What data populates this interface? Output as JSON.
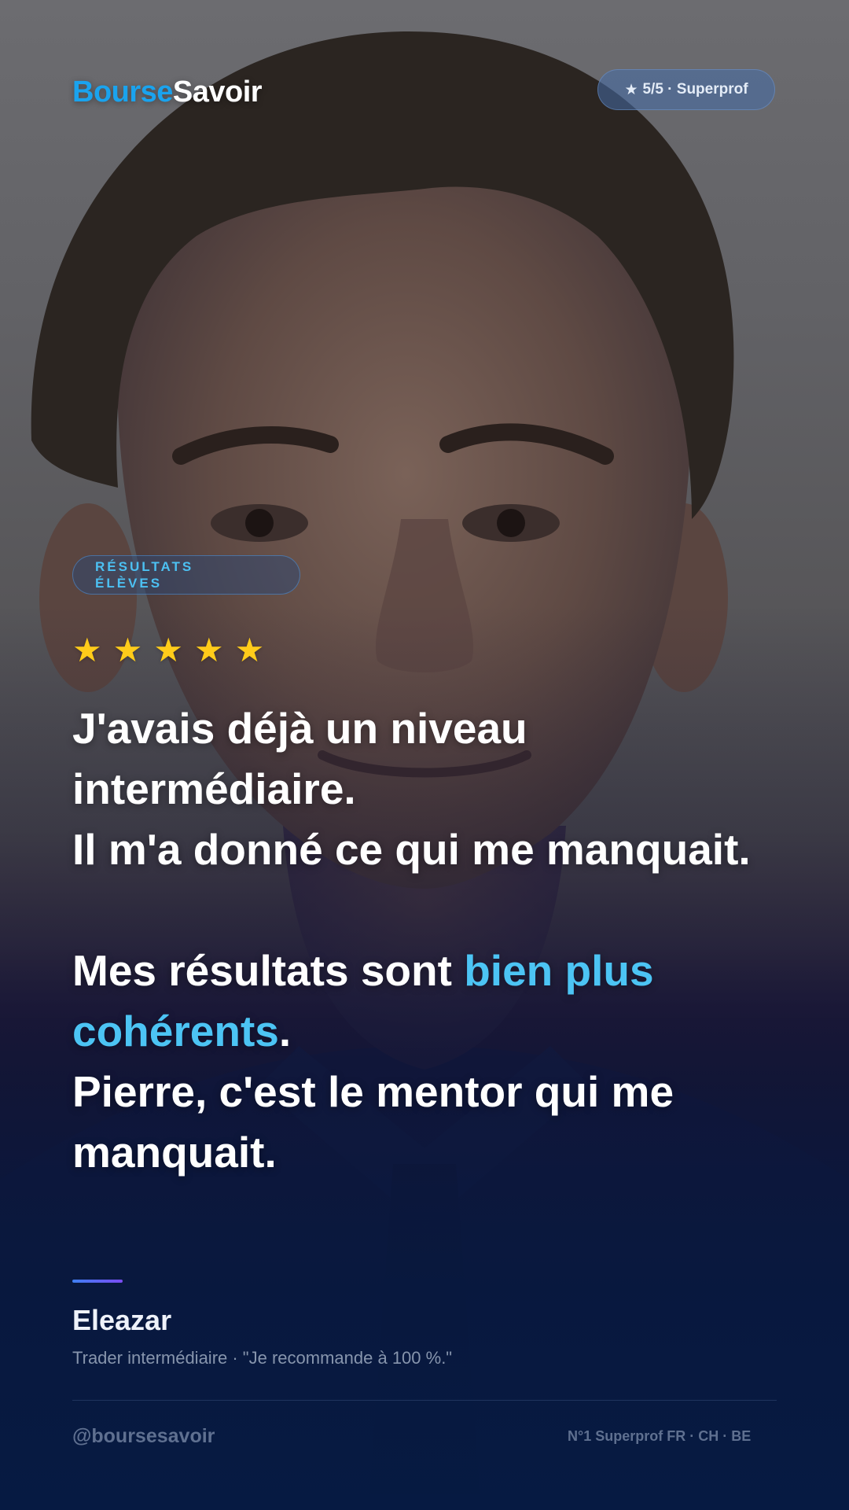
{
  "brand": {
    "logo_part1": "Bourse",
    "logo_part2": "Savoir",
    "color_primary": "#1aa3ee"
  },
  "rating_badge": {
    "icon": "star-icon",
    "text": "5/5 · Superprof"
  },
  "tag": {
    "line1": "RÉSULTATS",
    "line2": "ÉLÈVES"
  },
  "stars": {
    "rating": 5,
    "max": 5,
    "icon": "star-icon",
    "color": "#ffcc1a"
  },
  "testimonial": {
    "line1": "J'avais déjà un niveau intermédiaire.",
    "line2": "Il m'a donné ce qui me manquait.",
    "line3_before": "Mes résultats sont ",
    "line3_highlight": "bien plus cohérents",
    "line3_after": ".",
    "line4": "Pierre, c'est le mentor qui me manquait.",
    "highlight_color": "#4cc4f4"
  },
  "author": {
    "name": "Eleazar",
    "meta": "Trader intermédiaire · \"Je recommande à 100 %.\""
  },
  "footer": {
    "handle": "@boursesavoir",
    "tagline": "N°1 Superprof FR · CH · BE"
  }
}
